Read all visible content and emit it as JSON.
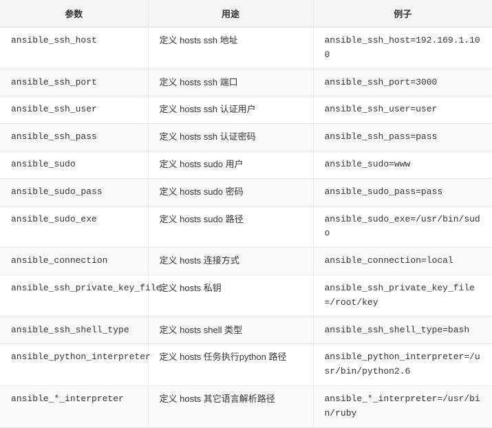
{
  "table": {
    "headers": [
      "参数",
      "用途",
      "例子"
    ],
    "rows": [
      {
        "param": "ansible_ssh_host",
        "usage": "定义 hosts ssh 地址",
        "example": "ansible_ssh_host=192.169.1.100"
      },
      {
        "param": "ansible_ssh_port",
        "usage": "定义 hosts ssh 端口",
        "example": "ansible_ssh_port=3000"
      },
      {
        "param": "ansible_ssh_user",
        "usage": "定义 hosts ssh 认证用户",
        "example": "ansible_ssh_user=user"
      },
      {
        "param": "ansible_ssh_pass",
        "usage": "定义 hosts ssh 认证密码",
        "example": "ansible_ssh_pass=pass"
      },
      {
        "param": "ansible_sudo",
        "usage": "定义 hosts sudo 用户",
        "example": "ansible_sudo=www"
      },
      {
        "param": "ansible_sudo_pass",
        "usage": "定义 hosts sudo 密码",
        "example": "ansible_sudo_pass=pass"
      },
      {
        "param": "ansible_sudo_exe",
        "usage": "定义 hosts sudo 路径",
        "example": "ansible_sudo_exe=/usr/bin/sudo"
      },
      {
        "param": "ansible_connection",
        "usage": "定义 hosts 连接方式",
        "example": "ansible_connection=local"
      },
      {
        "param": "ansible_ssh_private_key_file",
        "usage": "定义 hosts 私钥",
        "example": "ansible_ssh_private_key_file=/root/key"
      },
      {
        "param": "ansible_ssh_shell_type",
        "usage": "定义 hosts shell 类型",
        "example": "ansible_ssh_shell_type=bash"
      },
      {
        "param": "ansible_python_interpreter",
        "usage": "定义 hosts 任务执行python 路径",
        "example": "ansible_python_interpreter=/usr/bin/python2.6"
      },
      {
        "param": "ansible_*_interpreter",
        "usage": "定义 hosts 其它语言解析路径",
        "example": "ansible_*_interpreter=/usr/bin/ruby"
      }
    ]
  }
}
